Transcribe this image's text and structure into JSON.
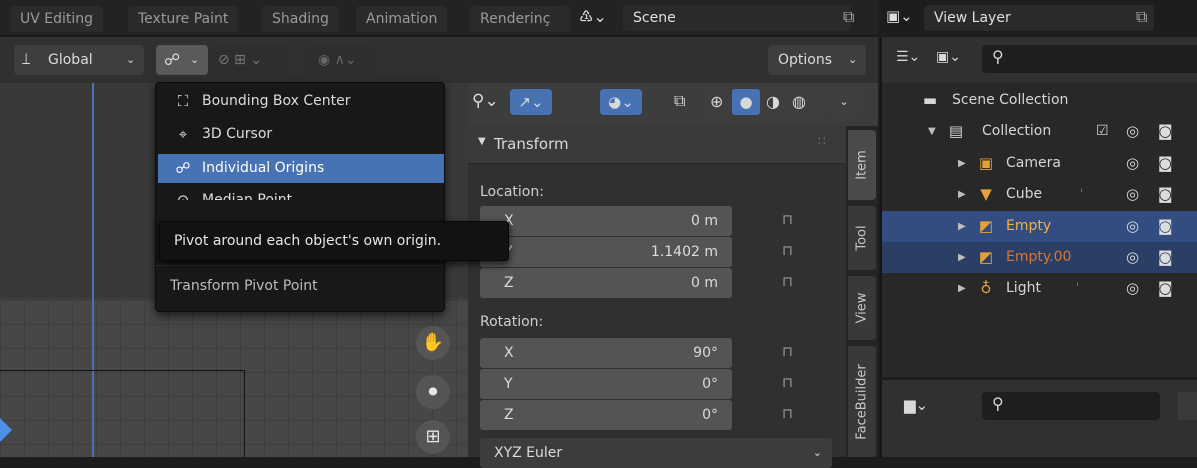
{
  "workspace_tabs": [
    "UV Editing",
    "Texture Paint",
    "Shading",
    "Animation",
    "Renderinç"
  ],
  "scene": {
    "label": "Scene"
  },
  "view_layer": {
    "label": "View Layer"
  },
  "viewport_header": {
    "orientation": "Global",
    "options": "Options"
  },
  "pivot_menu": {
    "items": [
      {
        "label": "Bounding Box Center",
        "icon": "bounding-box-icon"
      },
      {
        "label": "3D Cursor",
        "icon": "cursor-icon"
      },
      {
        "label": "Individual Origins",
        "icon": "individual-origins-icon",
        "selected": true
      },
      {
        "label": "Median Point",
        "icon": "median-point-icon"
      }
    ],
    "footer": "Transform Pivot Point"
  },
  "tooltip": {
    "text": "Pivot around each object's own origin."
  },
  "transform_panel": {
    "title": "Transform",
    "location_label": "Location:",
    "location": [
      {
        "axis": "X",
        "value": "0 m"
      },
      {
        "axis": "Y",
        "value": "1.1402 m"
      },
      {
        "axis": "Z",
        "value": "0 m"
      }
    ],
    "rotation_label": "Rotation:",
    "rotation": [
      {
        "axis": "X",
        "value": "90°"
      },
      {
        "axis": "Y",
        "value": "0°"
      },
      {
        "axis": "Z",
        "value": "0°"
      }
    ],
    "rotation_mode": "XYZ Euler"
  },
  "sidebar_tabs": [
    "Item",
    "Tool",
    "View",
    "FaceBuilder"
  ],
  "outliner": {
    "root": "Scene Collection",
    "collection": "Collection",
    "items": [
      {
        "name": "Camera",
        "icon": "camera-icon",
        "color": "#e3a23a"
      },
      {
        "name": "Cube",
        "icon": "mesh-icon",
        "color": "#e8a13a"
      },
      {
        "name": "Empty",
        "icon": "empty-icon",
        "color": "#e8a13a"
      },
      {
        "name": "Empty.00",
        "icon": "empty-icon",
        "color": "#e8a13a"
      },
      {
        "name": "Light",
        "icon": "light-icon",
        "color": "#e8a13a"
      }
    ]
  },
  "colors": {
    "accent": "#4772b3",
    "selected_row": "#334d80"
  }
}
